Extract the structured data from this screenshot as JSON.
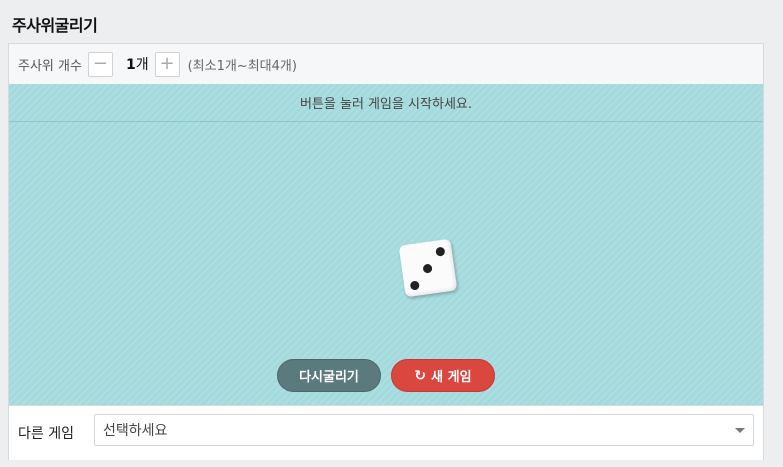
{
  "page": {
    "title": "주사위굴리기"
  },
  "dice_count": {
    "label": "주사위 개수",
    "minus_label": "−",
    "value": "1",
    "unit": "개",
    "plus_label": "+",
    "hint": "(최소1개~최대4개)"
  },
  "board": {
    "message": "버튼을 눌러 게임을 시작하세요.",
    "die_face": 3,
    "background_color": "#a4dadd"
  },
  "buttons": {
    "reroll_label": "다시굴리기",
    "newgame_icon": "refresh-icon",
    "newgame_label": "새 게임",
    "reroll_color": "#5b7a7d",
    "newgame_color": "#d9473f"
  },
  "footer": {
    "label": "다른 게임",
    "select_value": "선택하세요"
  }
}
